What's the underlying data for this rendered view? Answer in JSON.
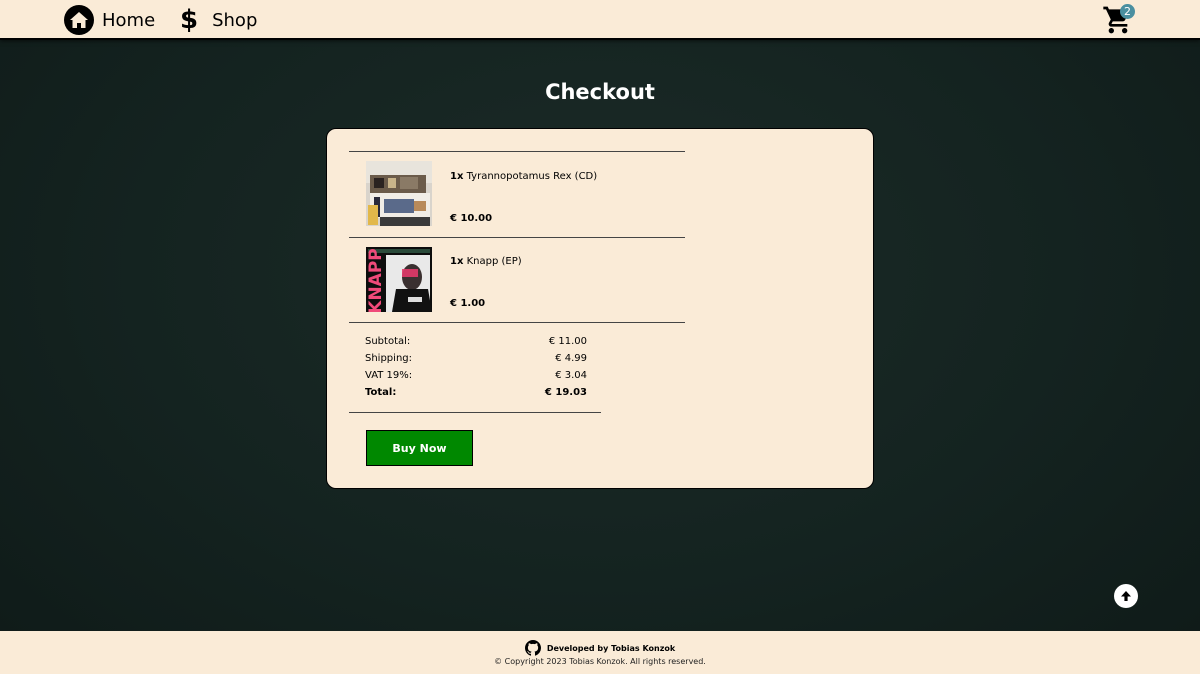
{
  "nav": {
    "home_label": "Home",
    "shop_label": "Shop",
    "shop_icon_glyph": "$",
    "cart_count": "2"
  },
  "page_title": "Checkout",
  "items": [
    {
      "qty": "1x",
      "name": "Tyrannopotamus Rex (CD)",
      "price": "€ 10.00",
      "image_icon": "album-cover-image"
    },
    {
      "qty": "1x",
      "name": "Knapp (EP)",
      "price": "€ 1.00",
      "image_icon": "album-cover-image",
      "cover_text": "KNAPP"
    }
  ],
  "summary": {
    "subtotal_label": "Subtotal:",
    "subtotal_value": "€ 11.00",
    "shipping_label": "Shipping:",
    "shipping_value": "€ 4.99",
    "vat_label": "VAT 19%:",
    "vat_value": "€ 3.04",
    "total_label": "Total:",
    "total_value": "€ 19.03"
  },
  "buy_label": "Buy Now",
  "footer": {
    "developed_by": "Developed by Tobias Konzok",
    "copyright": "© Copyright 2023 Tobias Konzok. All rights reserved."
  },
  "colors": {
    "cream": "#faebd7",
    "background": "#142320",
    "buy_button": "#008800",
    "badge": "#4a8fa0"
  }
}
